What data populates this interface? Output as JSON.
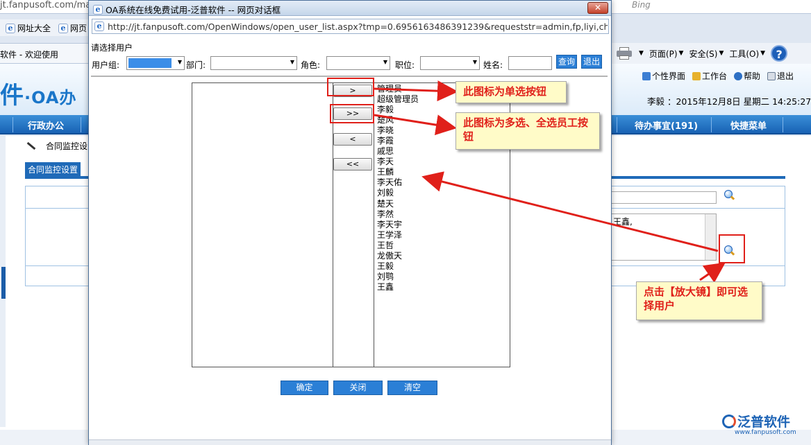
{
  "background": {
    "url_fragment": "jt.fanpusoft.com/mai",
    "search_placeholder": "Bing",
    "favorites": [
      {
        "label": "网址大全"
      },
      {
        "label": "网页"
      }
    ],
    "tab_title": "软件 - 欢迎使用",
    "command_bar": {
      "page": "页面(P)",
      "safety": "安全(S)",
      "tools": "工具(O)",
      "help": "?"
    },
    "logo_text": "件",
    "logo_sub": "·OA办",
    "top_links": {
      "personal": "个性界面",
      "workbench": "工作台",
      "help": "帮助",
      "logout": "退出"
    },
    "user_line": "李毅 ：2015年12月8日 星期二 14:25:27",
    "nav": {
      "admin_office": "行政办公",
      "todo": "待办事宜(191)",
      "shortcuts": "快捷菜单"
    },
    "breadcrumb": "合同监控设",
    "tab_label": "合同监控设置",
    "selected_value": "王鑫,",
    "brand": {
      "name": "泛普软件",
      "url": "www.fanpusoft.com"
    }
  },
  "dialog": {
    "title": "OA系统在线免费试用-泛普软件 -- 网页对话框",
    "close_label": "✕",
    "address": "http://jt.fanpusoft.com/OpenWindows/open_user_list.aspx?tmp=0.6956163486391239&requeststr=admin,fp,liyi,chufeng,lixiao",
    "prompt": "请选择用户",
    "filters": {
      "user_group_label": "用户组:",
      "department_label": "部门:",
      "role_label": "角色:",
      "position_label": "职位:",
      "name_label": "姓名:",
      "search_button": "查询",
      "exit_button": "退出"
    },
    "move_buttons": {
      "single_right": ">",
      "all_right": ">>",
      "single_left": "<",
      "all_left": "<<"
    },
    "users": [
      "管理员",
      "超级管理员",
      "李毅",
      "楚风",
      "李晓",
      "李霞",
      "戚思",
      "李天",
      "王麟",
      "李天佑",
      "刘毅",
      "楚天",
      "李然",
      "李天宇",
      "王学泽",
      "王哲",
      "龙傲天",
      "王毅",
      "刘鹗",
      "王鑫"
    ],
    "bottom_buttons": {
      "confirm": "确定",
      "close": "关闭",
      "clear": "清空"
    }
  },
  "annotations": {
    "single_select": "此图标为单选按钮",
    "multi_select": "此图标为多选、全选员工按钮",
    "magnifier": "点击【放大镜】即可选择用户"
  },
  "colors": {
    "accent_blue": "#2b7fd6",
    "annotation_red": "#e0201a",
    "callout_bg": "#fffbc8"
  }
}
